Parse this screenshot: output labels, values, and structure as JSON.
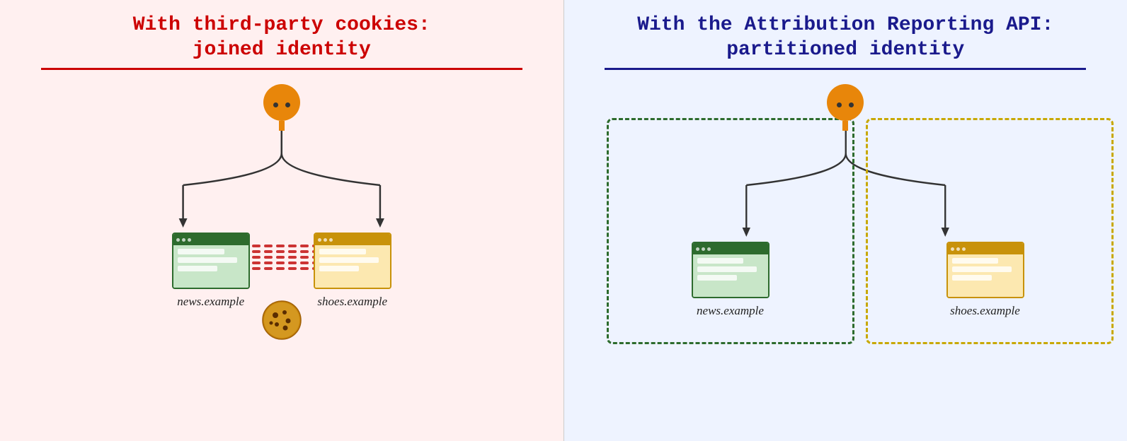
{
  "left_panel": {
    "title_line1": "With third-party cookies:",
    "title_line2": "joined identity",
    "background": "#fff0f0",
    "divider_color": "#cc0000",
    "site1_label": "news.example",
    "site2_label": "shoes.example"
  },
  "right_panel": {
    "title_line1": "With the Attribution Reporting API:",
    "title_line2": "partitioned identity",
    "background": "#eef3ff",
    "divider_color": "#1a1a8c",
    "site1_label": "news.example",
    "site2_label": "shoes.example"
  }
}
